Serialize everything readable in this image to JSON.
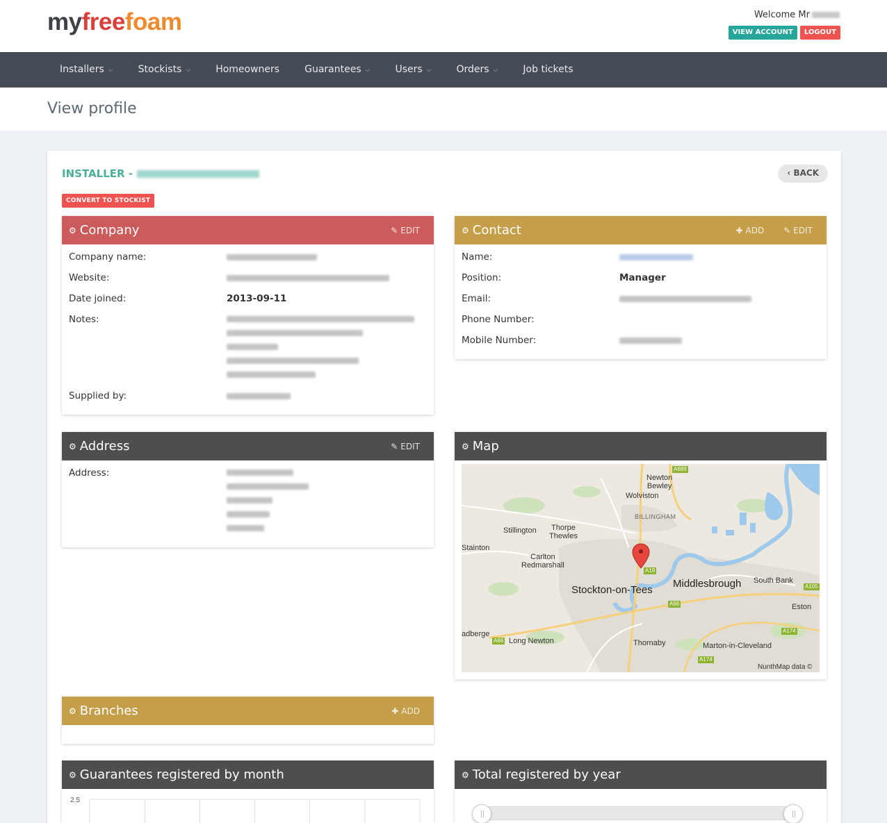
{
  "header": {
    "logo": {
      "my": "my",
      "free": "free",
      "foam": "foam"
    },
    "welcome": "Welcome Mr",
    "view_account": "VIEW ACCOUNT",
    "logout": "LOGOUT"
  },
  "nav": [
    {
      "label": "Installers",
      "dropdown": true
    },
    {
      "label": "Stockists",
      "dropdown": true
    },
    {
      "label": "Homeowners",
      "dropdown": false
    },
    {
      "label": "Guarantees",
      "dropdown": true
    },
    {
      "label": "Users",
      "dropdown": true
    },
    {
      "label": "Orders",
      "dropdown": true
    },
    {
      "label": "Job tickets",
      "dropdown": false
    }
  ],
  "page_title": "View profile",
  "profile": {
    "heading_prefix": "INSTALLER -",
    "back": "BACK",
    "convert": "CONVERT TO STOCKIST"
  },
  "company": {
    "title": "Company",
    "edit": "EDIT",
    "labels": {
      "name": "Company name:",
      "website": "Website:",
      "joined": "Date joined:",
      "notes": "Notes:",
      "supplied": "Supplied by:"
    },
    "date_joined": "2013-09-11"
  },
  "contact": {
    "title": "Contact",
    "add": "ADD",
    "edit": "EDIT",
    "labels": {
      "name": "Name:",
      "position": "Position:",
      "email": "Email:",
      "phone": "Phone Number:",
      "mobile": "Mobile Number:"
    },
    "position": "Manager"
  },
  "address": {
    "title": "Address",
    "edit": "EDIT",
    "label": "Address:"
  },
  "map": {
    "title": "Map",
    "labels": {
      "newton_bewley": "Newton\nBewley",
      "wolviston": "Wolviston",
      "billingham": "BILLINGHAM",
      "stillington": "Stillington",
      "thorpe_thewles": "Thorpe\nThewles",
      "stainton": "Stainton",
      "carlton": "Carlton\nRedmarshall",
      "stockton": "Stockton-on-Tees",
      "middlesbrough": "Middlesbrough",
      "south_bank": "South Bank",
      "eston": "Eston",
      "adberge": "adberge",
      "long_newton": "Long Newton",
      "thornaby": "Thornaby",
      "marton": "Marton-in-Cleveland",
      "attribution": "NunthMap data ©"
    },
    "roads": {
      "a689": "A689",
      "a19": "A19",
      "a66": "A66",
      "a66b": "A66",
      "a174": "A174",
      "a174b": "A174",
      "a105": "A105"
    }
  },
  "branches": {
    "title": "Branches",
    "add": "ADD"
  },
  "charts": {
    "by_month_title": "Guarantees registered by month",
    "by_year_title": "Total registered by year"
  },
  "chart_data": [
    {
      "type": "bar",
      "title": "Guarantees registered by month",
      "ylim": [
        0,
        2.5
      ],
      "yticks": [
        2.5
      ],
      "categories": [],
      "values": []
    },
    {
      "type": "line",
      "title": "Total registered by year",
      "x": [],
      "values": []
    }
  ],
  "colors": {
    "nav_bg": "#454b55",
    "company_header": "#cc5c5c",
    "contact_header": "#c49e48",
    "dark_header": "#4e4e4e",
    "heading_teal": "#4caf9a",
    "logout_red": "#ef5350",
    "view_account_teal": "#26a69a"
  }
}
